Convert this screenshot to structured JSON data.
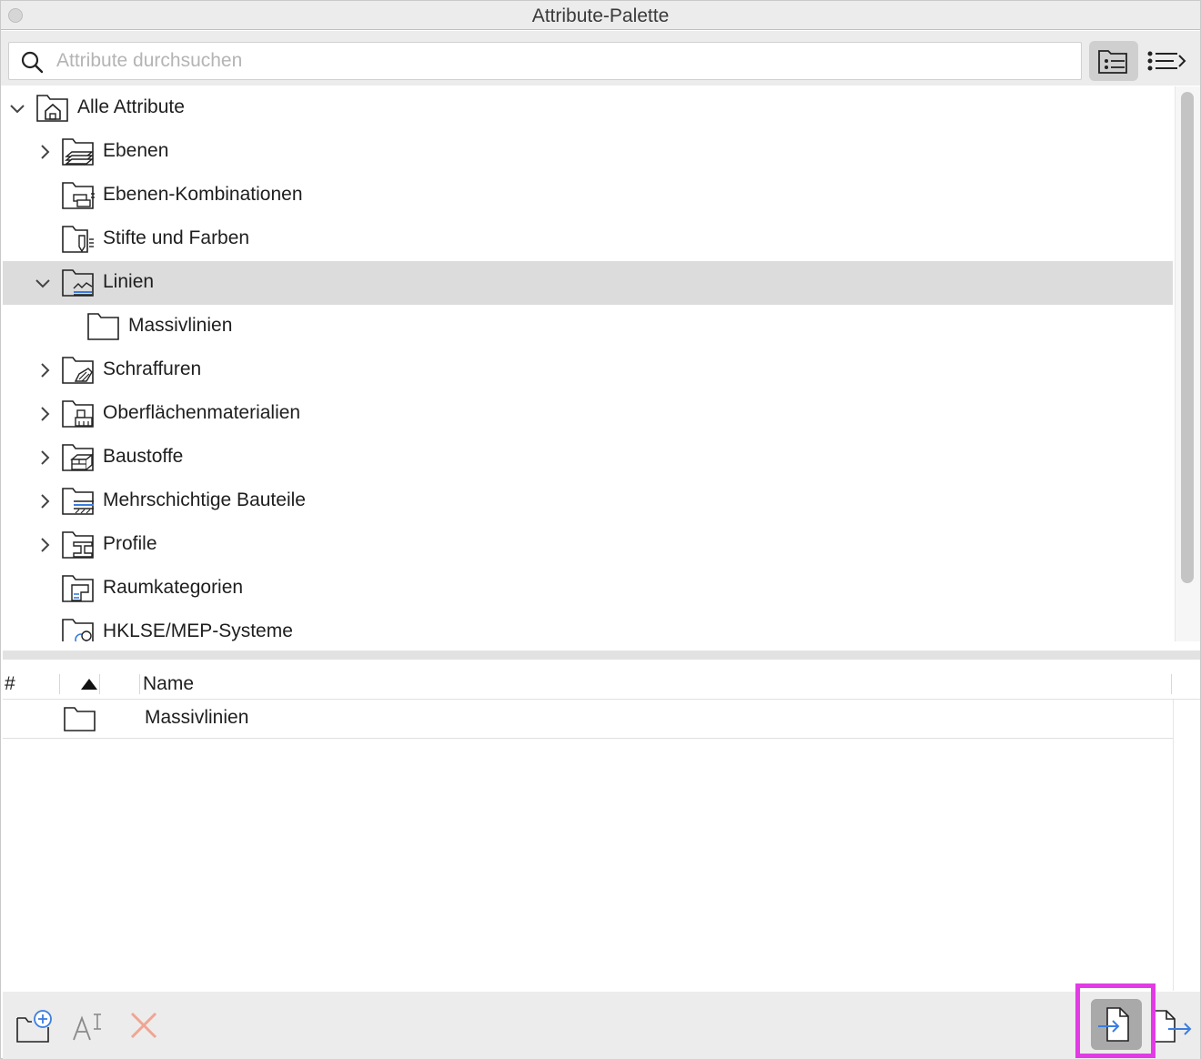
{
  "window": {
    "title": "Attribute-Palette"
  },
  "search": {
    "placeholder": "Attribute durchsuchen",
    "value": ""
  },
  "view_buttons": [
    {
      "name": "tree-view",
      "active": true
    },
    {
      "name": "list-view",
      "active": false
    }
  ],
  "tree": {
    "items": [
      {
        "label": "Alle Attribute",
        "expanded": true,
        "icon": "home-folder-icon"
      },
      {
        "label": "Ebenen",
        "expanded": false,
        "icon": "layers-folder-icon"
      },
      {
        "label": "Ebenen-Kombinationen",
        "icon": "layer-combinations-folder-icon"
      },
      {
        "label": "Stifte und Farben",
        "icon": "pens-folder-icon"
      },
      {
        "label": "Linien",
        "expanded": true,
        "selected": true,
        "icon": "lines-folder-icon"
      },
      {
        "label": "Massivlinien",
        "icon": "folder-icon"
      },
      {
        "label": "Schraffuren",
        "expanded": false,
        "icon": "fills-folder-icon"
      },
      {
        "label": "Oberflächenmaterialien",
        "expanded": false,
        "icon": "surfaces-folder-icon"
      },
      {
        "label": "Baustoffe",
        "expanded": false,
        "icon": "building-materials-folder-icon"
      },
      {
        "label": "Mehrschichtige Bauteile",
        "expanded": false,
        "icon": "composites-folder-icon"
      },
      {
        "label": "Profile",
        "expanded": false,
        "icon": "profiles-folder-icon"
      },
      {
        "label": "Raumkategorien",
        "icon": "zone-categories-folder-icon"
      },
      {
        "label": "HKLSE/MEP-Systeme",
        "icon": "mep-systems-folder-icon"
      }
    ]
  },
  "list": {
    "columns": {
      "number": "#",
      "name": "Name"
    },
    "sort": "ascending",
    "rows": [
      {
        "name": "Massivlinien",
        "icon": "folder-icon"
      }
    ]
  },
  "colors": {
    "accent_blue": "#3b7de0",
    "delete_red": "#f0a592",
    "highlight": "#e23be5",
    "selection": "#dcdcdc"
  }
}
